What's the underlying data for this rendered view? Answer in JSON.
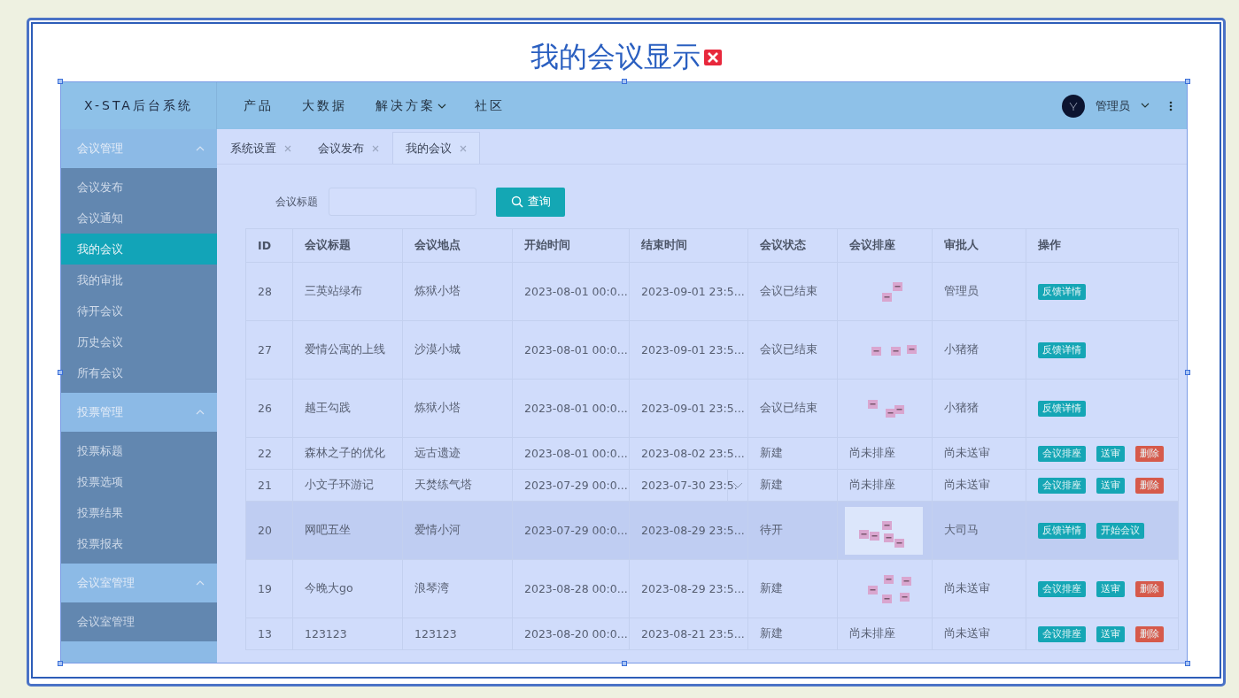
{
  "title": "我的会议显示",
  "app": {
    "brand": "X-STA后台系统",
    "nav": [
      {
        "label": "产品",
        "dropdown": false
      },
      {
        "label": "大数据",
        "dropdown": false
      },
      {
        "label": "解决方案",
        "dropdown": true
      },
      {
        "label": "社区",
        "dropdown": false
      }
    ],
    "user": "管理员",
    "sidebar": [
      {
        "label": "会议管理",
        "expanded": true,
        "children": [
          {
            "label": "会议发布",
            "selected": false
          },
          {
            "label": "会议通知",
            "selected": false
          },
          {
            "label": "我的会议",
            "selected": true
          },
          {
            "label": "我的审批",
            "selected": false
          },
          {
            "label": "待开会议",
            "selected": false
          },
          {
            "label": "历史会议",
            "selected": false
          },
          {
            "label": "所有会议",
            "selected": false
          }
        ]
      },
      {
        "label": "投票管理",
        "expanded": true,
        "children": [
          {
            "label": "投票标题",
            "selected": false
          },
          {
            "label": "投票选项",
            "selected": false
          },
          {
            "label": "投票结果",
            "selected": false
          },
          {
            "label": "投票报表",
            "selected": false
          }
        ]
      },
      {
        "label": "会议室管理",
        "expanded": true,
        "children": [
          {
            "label": "会议室管理",
            "selected": false
          }
        ]
      }
    ],
    "tabs": [
      {
        "label": "系统设置",
        "selected": false
      },
      {
        "label": "会议发布",
        "selected": false
      },
      {
        "label": "我的会议",
        "selected": true
      }
    ],
    "search": {
      "label": "会议标题",
      "button": "查询"
    },
    "table": {
      "columns": [
        "ID",
        "会议标题",
        "会议地点",
        "开始时间",
        "结束时间",
        "会议状态",
        "会议排座",
        "审批人",
        "操作"
      ],
      "rows": [
        {
          "id": "28",
          "title": "三英站绿布",
          "place": "炼狱小塔",
          "start": "2023-08-01 00:0...",
          "end": "2023-09-01 23:5...",
          "end_menu": false,
          "status": "会议已结束",
          "seating": {
            "kind": "drawing"
          },
          "approver": "管理员",
          "highlighted": false,
          "actions": [
            {
              "label": "反馈详情",
              "kind": "primary"
            }
          ]
        },
        {
          "id": "27",
          "title": "爱情公寓的上线",
          "place": "沙漠小城",
          "start": "2023-08-01 00:0...",
          "end": "2023-09-01 23:5...",
          "end_menu": false,
          "status": "会议已结束",
          "seating": {
            "kind": "drawing"
          },
          "approver": "小猪猪",
          "highlighted": false,
          "actions": [
            {
              "label": "反馈详情",
              "kind": "primary"
            }
          ]
        },
        {
          "id": "26",
          "title": "越王勾践",
          "place": "炼狱小塔",
          "start": "2023-08-01 00:0...",
          "end": "2023-09-01 23:5...",
          "end_menu": false,
          "status": "会议已结束",
          "seating": {
            "kind": "drawing"
          },
          "approver": "小猪猪",
          "highlighted": false,
          "actions": [
            {
              "label": "反馈详情",
              "kind": "primary"
            }
          ]
        },
        {
          "id": "22",
          "title": "森林之子的优化",
          "place": "远古遗迹",
          "start": "2023-08-01 00:0...",
          "end": "2023-08-02 23:5...",
          "end_menu": false,
          "status": "新建",
          "seating": {
            "kind": "text",
            "text": "尚未排座"
          },
          "approver": "尚未送审",
          "highlighted": false,
          "actions": [
            {
              "label": "会议排座",
              "kind": "primary"
            },
            {
              "label": "送审",
              "kind": "primary"
            },
            {
              "label": "删除",
              "kind": "danger"
            }
          ]
        },
        {
          "id": "21",
          "title": "小文子环游记",
          "place": "天焚练气塔",
          "start": "2023-07-29 00:0...",
          "end": "2023-07-30 23:5.",
          "end_menu": true,
          "status": "新建",
          "seating": {
            "kind": "text",
            "text": "尚未排座"
          },
          "approver": "尚未送审",
          "highlighted": false,
          "actions": [
            {
              "label": "会议排座",
              "kind": "primary"
            },
            {
              "label": "送审",
              "kind": "primary"
            },
            {
              "label": "删除",
              "kind": "danger"
            }
          ]
        },
        {
          "id": "20",
          "title": "网吧五坐",
          "place": "爱情小河",
          "start": "2023-07-29 00:0...",
          "end": "2023-08-29 23:5...",
          "end_menu": false,
          "status": "待开",
          "seating": {
            "kind": "drawing"
          },
          "approver": "大司马",
          "highlighted": true,
          "actions": [
            {
              "label": "反馈详情",
              "kind": "primary"
            },
            {
              "label": "开始会议",
              "kind": "primary"
            }
          ]
        },
        {
          "id": "19",
          "title": "今晚大go",
          "place": "浪琴湾",
          "start": "2023-08-28 00:0...",
          "end": "2023-08-29 23:5...",
          "end_menu": false,
          "status": "新建",
          "seating": {
            "kind": "drawing"
          },
          "approver": "尚未送审",
          "highlighted": false,
          "actions": [
            {
              "label": "会议排座",
              "kind": "primary"
            },
            {
              "label": "送审",
              "kind": "primary"
            },
            {
              "label": "删除",
              "kind": "danger"
            }
          ]
        },
        {
          "id": "13",
          "title": "123123",
          "place": "123123",
          "start": "2023-08-20 00:0...",
          "end": "2023-08-21 23:5...",
          "end_menu": false,
          "status": "新建",
          "seating": {
            "kind": "text",
            "text": "尚未排座"
          },
          "approver": "尚未送审",
          "highlighted": false,
          "actions": [
            {
              "label": "会议排座",
              "kind": "primary"
            },
            {
              "label": "送审",
              "kind": "primary"
            },
            {
              "label": "删除",
              "kind": "danger"
            }
          ]
        }
      ]
    }
  }
}
